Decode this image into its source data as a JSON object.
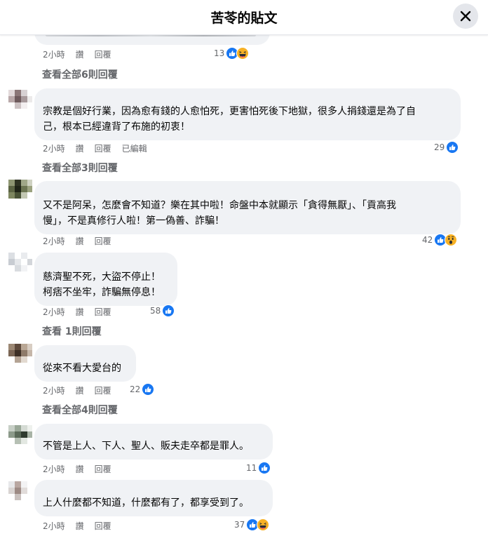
{
  "header": {
    "title": "苦苓的貼文"
  },
  "action_labels": {
    "like": "讚",
    "reply": "回覆"
  },
  "comments": [
    {
      "time": "2小時",
      "edited": "",
      "count": "13",
      "replies": "查看全部6則回覆"
    },
    {
      "lines": [
        "宗教是個好行業，因為愈有錢的人愈怕死，更害怕死後下地獄，很多人捐錢還是為了自",
        "己，根本已經違背了布施的初衷！"
      ],
      "time": "2小時",
      "edited": "已編輯",
      "count": "29",
      "replies": "查看全部3則回覆"
    },
    {
      "lines": [
        "又不是阿呆，怎麼會不知道？樂在其中啦！命盤中本就顯示「貪得無厭」、「貢高我",
        "慢」，不是真修行人啦！第一偽善、詐騙！"
      ],
      "time": "2小時",
      "count": "42"
    },
    {
      "lines": [
        "慈濟聖不死，大盜不停止！",
        "柯痞不坐牢，詐騙無停息！"
      ],
      "time": "2小時",
      "count": "58",
      "replies": "查看 1則回覆"
    },
    {
      "lines": [
        "從來不看大愛台的"
      ],
      "time": "2小時",
      "count": "22",
      "replies": "查看全部4則回覆"
    },
    {
      "lines": [
        "不管是上人、下人、聖人、販夫走卒都是罪人。"
      ],
      "time": "2小時",
      "count": "11"
    },
    {
      "lines": [
        "上人什麼都不知道，什麼都有了，都享受到了。"
      ],
      "time": "2小時",
      "count": "37"
    }
  ],
  "colors": {
    "like_blue": "#1877f2",
    "secondary_text": "#65676b",
    "bubble_bg": "#f0f2f5",
    "haha_yellow": "#f7b125",
    "wow_yellow": "#f7b125"
  },
  "icons": {
    "close": "close-icon",
    "like": "like-reaction-icon",
    "haha": "haha-reaction-icon",
    "wow": "wow-reaction-icon"
  }
}
